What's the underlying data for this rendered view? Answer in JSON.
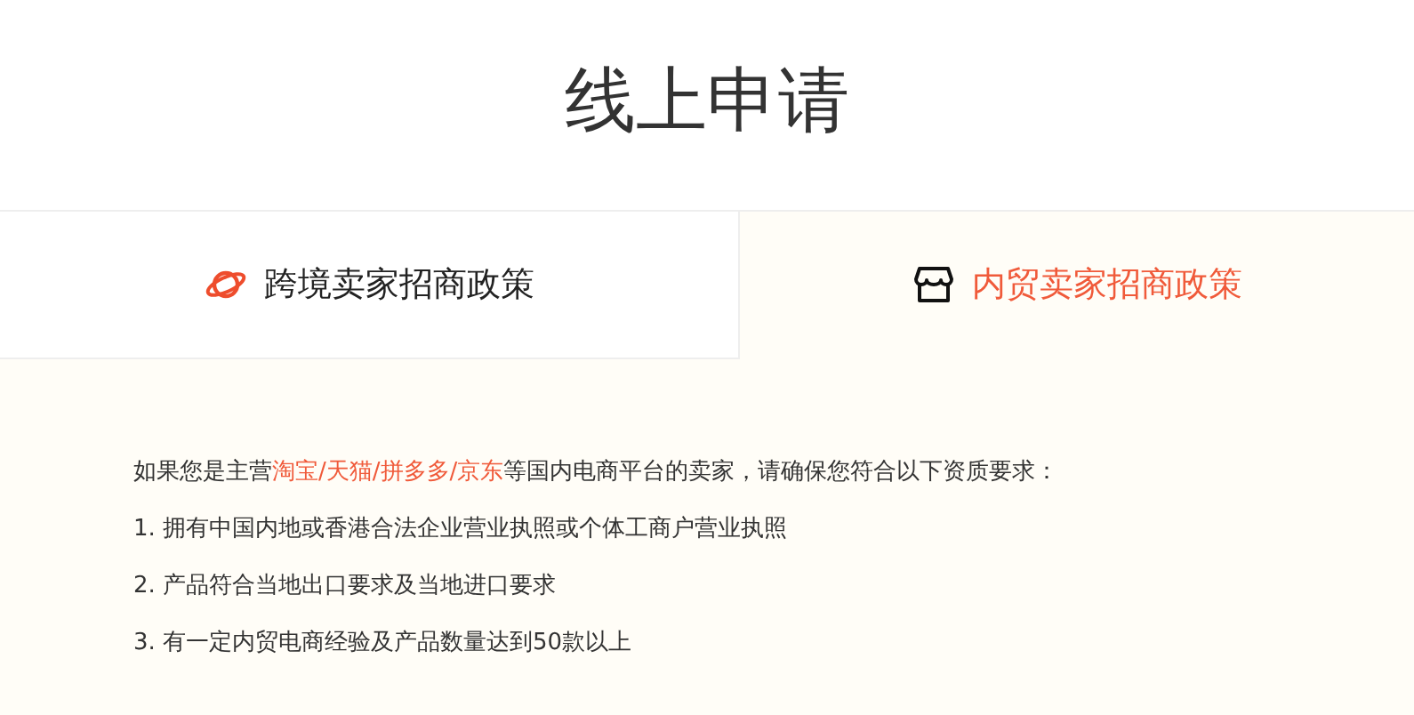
{
  "title": "线上申请",
  "tabs": [
    {
      "label": "跨境卖家招商政策",
      "selected": false
    },
    {
      "label": "内贸卖家招商政策",
      "selected": true
    }
  ],
  "intro": {
    "before": "如果您是主营",
    "highlight": "淘宝/天猫/拼多多/京东",
    "after": "等国内电商平台的卖家，请确保您符合以下资质要求："
  },
  "requirements": [
    "1. 拥有中国内地或香港合法企业营业执照或个体工商户营业执照",
    "2. 产品符合当地出口要求及当地进口要求",
    "3. 有一定内贸电商经验及产品数量达到50款以上"
  ]
}
